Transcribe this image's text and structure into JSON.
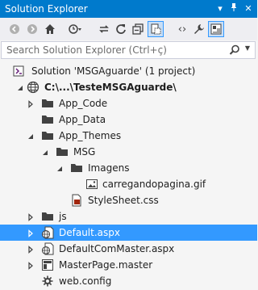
{
  "window": {
    "title": "Solution Explorer"
  },
  "search": {
    "placeholder": "Search Solution Explorer (Ctrl+ç)"
  },
  "tree": {
    "items": [
      {
        "label": "Solution 'MSGAguarde' (1 project)",
        "icon": "solution-icon",
        "level": 0
      },
      {
        "label": "C:\\...\\TesteMSGAguarde\\",
        "icon": "website-icon",
        "level": 0,
        "expanded": true
      },
      {
        "label": "App_Code",
        "icon": "folder-icon",
        "level": 1,
        "expanded": false
      },
      {
        "label": "App_Data",
        "icon": "folder-icon",
        "level": 1
      },
      {
        "label": "App_Themes",
        "icon": "folder-icon",
        "level": 1,
        "expanded": true
      },
      {
        "label": "MSG",
        "icon": "folder-icon",
        "level": 2,
        "expanded": true
      },
      {
        "label": "Imagens",
        "icon": "folder-icon",
        "level": 3,
        "expanded": true
      },
      {
        "label": "carregandopagina.gif",
        "icon": "image-file-icon",
        "level": 4
      },
      {
        "label": "StyleSheet.css",
        "icon": "css-file-icon",
        "level": 3
      },
      {
        "label": "js",
        "icon": "folder-icon",
        "level": 1,
        "expanded": false
      },
      {
        "label": "Default.aspx",
        "icon": "aspx-file-icon",
        "level": 1,
        "expanded": false,
        "selected": true
      },
      {
        "label": "DefaultComMaster.aspx",
        "icon": "aspx-file-icon",
        "level": 1,
        "expanded": false
      },
      {
        "label": "MasterPage.master",
        "icon": "master-file-icon",
        "level": 1,
        "expanded": false
      },
      {
        "label": "web.config",
        "icon": "config-file-icon",
        "level": 1
      }
    ]
  },
  "colors": {
    "accent": "#007acc",
    "selection": "#3399ff",
    "background": "#f5f5f5"
  }
}
